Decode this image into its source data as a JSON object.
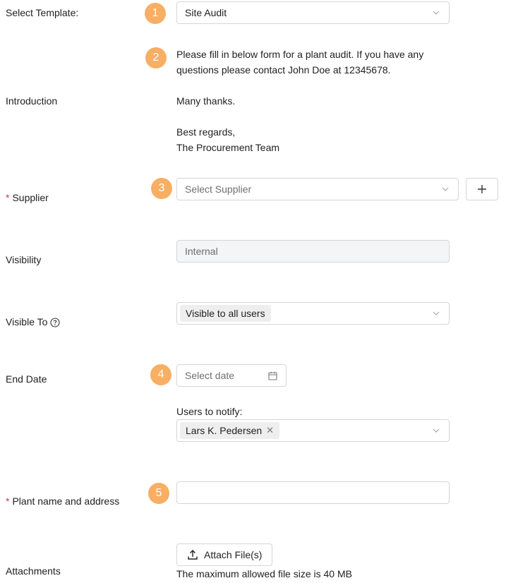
{
  "template": {
    "label": "Select Template:",
    "badge": "1",
    "value": "Site Audit"
  },
  "introduction": {
    "label": "Introduction",
    "badge": "2",
    "lines": [
      "Please fill in below form for a plant audit. If you have any",
      "questions please contact John Doe at 12345678.",
      "Many thanks.",
      "Best regards,",
      "The Procurement Team"
    ]
  },
  "supplier": {
    "required_mark": "*",
    "label": "Supplier",
    "badge": "3",
    "placeholder": "Select Supplier",
    "add_icon": "plus-icon"
  },
  "visibility": {
    "label": "Visibility",
    "value": "Internal"
  },
  "visible_to": {
    "label": "Visible To",
    "help_icon": "question-circle-icon",
    "value": "Visible to all users"
  },
  "end_date": {
    "label": "End Date",
    "badge": "4",
    "placeholder": "Select date",
    "icon": "calendar-icon"
  },
  "notify": {
    "label": "Users to notify:",
    "users": [
      "Lars K. Pedersen"
    ],
    "remove_icon": "close-icon"
  },
  "plant": {
    "required_mark": "*",
    "label": "Plant name and address",
    "badge": "5",
    "value": ""
  },
  "attachments": {
    "label": "Attachments",
    "button_label": "Attach File(s)",
    "button_icon": "upload-icon",
    "hint": "The maximum allowed file size is 40 MB"
  },
  "colors": {
    "badge": "#f8ae63",
    "required": "#e0342c",
    "border": "#d5d5d5"
  }
}
